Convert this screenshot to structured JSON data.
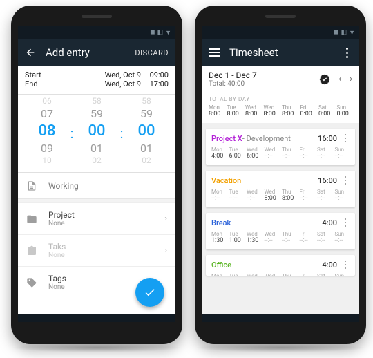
{
  "left": {
    "appbar": {
      "title": "Add entry",
      "discard": "DISCARD"
    },
    "start": {
      "label": "Start",
      "date": "Wed, Oct 9",
      "time": "09:00"
    },
    "end": {
      "label": "End",
      "date": "Wed, Oct 9",
      "time": "17:00"
    },
    "wheel": {
      "h": {
        "top": "06",
        "up": "07",
        "cur": "08",
        "down": "09",
        "bot": "10"
      },
      "m": {
        "top": "58",
        "up": "59",
        "cur": "00",
        "down": "01",
        "bot": "02"
      },
      "s": {
        "top": "58",
        "up": "59",
        "cur": "00",
        "down": "01",
        "bot": "02"
      }
    },
    "rows": {
      "working": "Working",
      "project": {
        "label": "Project",
        "value": "None"
      },
      "task": {
        "label": "Taks",
        "value": "None"
      },
      "tags": {
        "label": "Tags",
        "value": "None"
      }
    }
  },
  "right": {
    "appbar": {
      "title": "Timesheet"
    },
    "range": {
      "label": "Dec 1 - Dec 7",
      "total": "Total: 40:00"
    },
    "totals_label": "TOTAL BY DAY",
    "days": [
      "Mon",
      "Tue",
      "Wed",
      "Wed",
      "Thu",
      "Fri",
      "Sat",
      "Sun"
    ],
    "totals": [
      "8:00",
      "8:00",
      "8:00",
      "8:00",
      "8:00",
      "0:00",
      "0:00",
      "0:00"
    ],
    "cards": [
      {
        "name": "Project X",
        "color": "#b21fd6",
        "sub": " - Development",
        "total": "16:00",
        "vals": [
          "4:00",
          "6:00",
          "6:00",
          "--:--",
          "--:--",
          "--:--",
          "--:--",
          "--:--"
        ]
      },
      {
        "name": "Vacation",
        "color": "#f2a000",
        "sub": "",
        "total": "16:00",
        "vals": [
          "--:--",
          "--:--",
          "--:--",
          "8:00",
          "8:00",
          "--:--",
          "--:--",
          "--:--"
        ]
      },
      {
        "name": "Break",
        "color": "#2b62d9",
        "sub": "",
        "total": "4:00",
        "vals": [
          "1:30",
          "1:00",
          "1:30",
          "--:--",
          "--:--",
          "--:--",
          "--:--",
          "--:--"
        ]
      },
      {
        "name": "Office",
        "color": "#5fb72a",
        "sub": "",
        "total": "4:00",
        "vals": [
          "",
          "",
          "",
          "",
          "",
          "",
          "",
          ""
        ]
      }
    ]
  }
}
